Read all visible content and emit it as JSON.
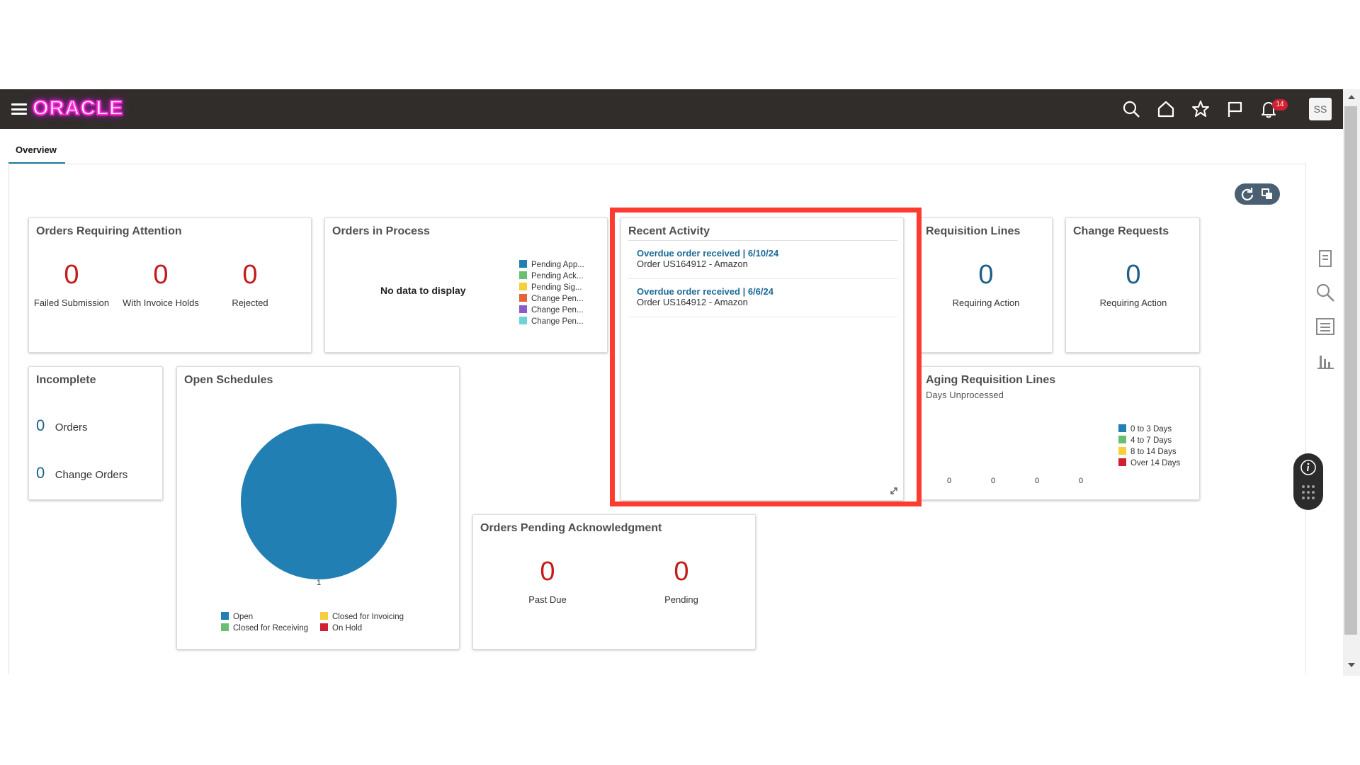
{
  "header": {
    "logo": "ORACLE",
    "notifications_count": "14",
    "avatar_initials": "SS"
  },
  "tabs": [
    {
      "label": "Overview"
    }
  ],
  "cards": {
    "orders_requiring_attention": {
      "title": "Orders Requiring Attention",
      "metrics": [
        {
          "value": "0",
          "label": "Failed Submission"
        },
        {
          "value": "0",
          "label": "With Invoice Holds"
        },
        {
          "value": "0",
          "label": "Rejected"
        }
      ]
    },
    "orders_in_process": {
      "title": "Orders in Process",
      "empty_text": "No data to display",
      "legend": [
        {
          "label": "Pending App...",
          "color": "#227fb4"
        },
        {
          "label": "Pending Ack...",
          "color": "#67bf6f"
        },
        {
          "label": "Pending Sig...",
          "color": "#f5cf3d"
        },
        {
          "label": "Change Pen...",
          "color": "#e5633d"
        },
        {
          "label": "Change Pen...",
          "color": "#8b5cc9"
        },
        {
          "label": "Change Pen...",
          "color": "#6fd3d7"
        }
      ]
    },
    "recent_activity": {
      "title": "Recent Activity",
      "items": [
        {
          "link": "Overdue order received | 6/10/24",
          "detail": "Order US164912 - Amazon"
        },
        {
          "link": "Overdue order received | 6/6/24",
          "detail": "Order US164912 - Amazon"
        }
      ]
    },
    "requisition_lines": {
      "title": "Requisition Lines",
      "value": "0",
      "label": "Requiring Action"
    },
    "change_requests": {
      "title": "Change Requests",
      "value": "0",
      "label": "Requiring Action"
    },
    "incomplete": {
      "title": "Incomplete",
      "rows": [
        {
          "value": "0",
          "label": "Orders"
        },
        {
          "value": "0",
          "label": "Change Orders"
        }
      ]
    },
    "open_schedules": {
      "title": "Open Schedules",
      "slice_label": "1",
      "legend": [
        {
          "label": "Open",
          "color": "#227fb4"
        },
        {
          "label": "Closed for Invoicing",
          "color": "#f5cf3d"
        },
        {
          "label": "Closed for Receiving",
          "color": "#67bf6f"
        },
        {
          "label": "On Hold",
          "color": "#d12030"
        }
      ]
    },
    "aging_requisition_lines": {
      "title": "Aging Requisition Lines",
      "subtitle": "Days Unprocessed",
      "values": [
        "0",
        "0",
        "0",
        "0"
      ],
      "legend": [
        {
          "label": "0 to 3 Days",
          "color": "#227fb4"
        },
        {
          "label": "4 to 7 Days",
          "color": "#67bf6f"
        },
        {
          "label": "8 to 14 Days",
          "color": "#f5cf3d"
        },
        {
          "label": "Over 14 Days",
          "color": "#d12030"
        }
      ]
    },
    "orders_pending_ack": {
      "title": "Orders Pending Acknowledgment",
      "metrics": [
        {
          "value": "0",
          "label": "Past Due"
        },
        {
          "value": "0",
          "label": "Pending"
        }
      ]
    }
  },
  "chart_data": {
    "type": "pie",
    "categories": [
      "Open",
      "Closed for Invoicing",
      "Closed for Receiving",
      "On Hold"
    ],
    "values": [
      1,
      0,
      0,
      0
    ],
    "title": "Open Schedules"
  }
}
